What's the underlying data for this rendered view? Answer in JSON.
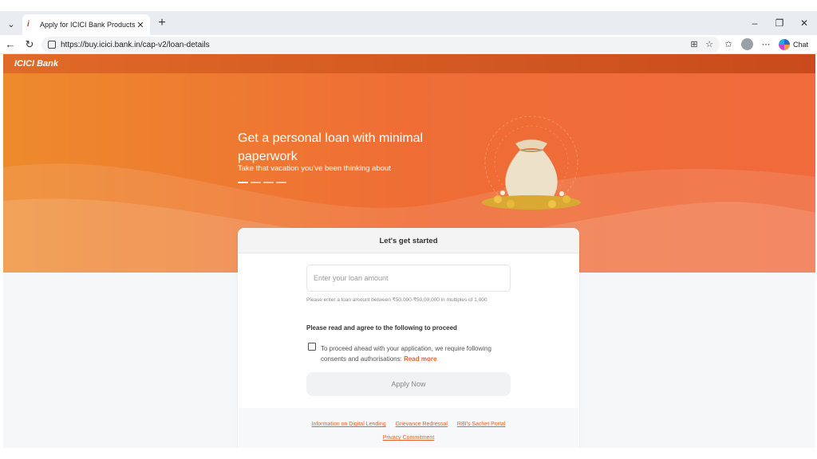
{
  "browser": {
    "tab_title": "Apply for ICICI Bank Products and",
    "url": "https://buy.icici.bank.in/cap-v2/loan-details",
    "chat_label": "Chat"
  },
  "site": {
    "logo_text": "ICICI Bank"
  },
  "hero": {
    "title": "Get a personal loan with minimal paperwork",
    "subtitle": "Take that vacation you've been thinking about",
    "carousel_count": 4,
    "carousel_active": 1
  },
  "form": {
    "heading": "Let's get started",
    "loan_amount_placeholder": "Enter your loan amount",
    "loan_amount_value": "",
    "hint": "Please enter a loan amount between ₹50,000-₹50,00,000 in multiples of 1,000",
    "agree_title": "Please read and agree to the following to proceed",
    "consent_text": "To proceed ahead with your application, we require following consents and authorisations:",
    "read_more": "Read more",
    "apply_label": "Apply Now"
  },
  "footer_links": [
    "Information on Digital Lending",
    "Grievance Redressal",
    "RBI's Sachet Portal",
    "Privacy Commitment"
  ],
  "colors": {
    "brand_orange": "#ef6d35",
    "header_red": "#c94a1c",
    "link_orange": "#e8602a"
  }
}
